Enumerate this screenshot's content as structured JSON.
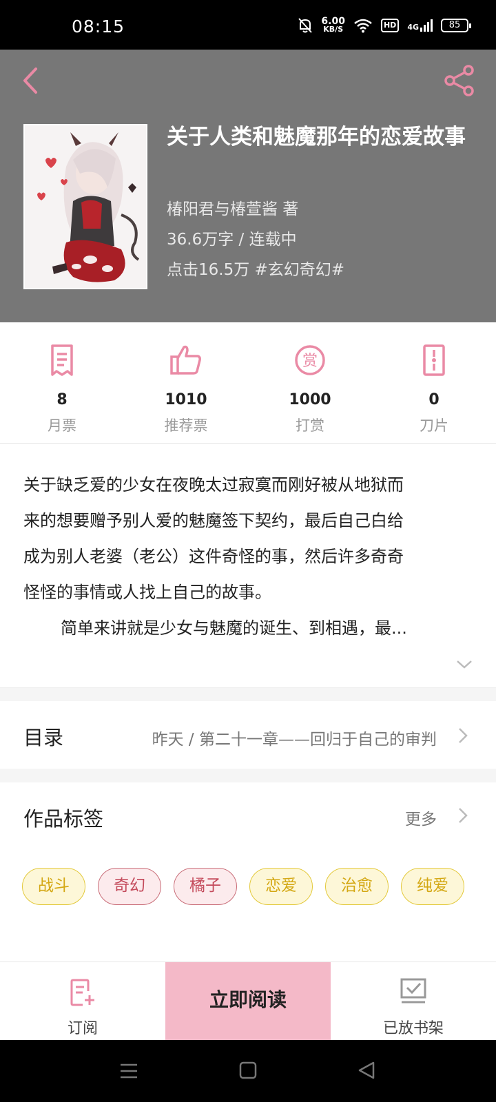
{
  "status_bar": {
    "time": "08:15",
    "net_speed_value": "6.00",
    "net_speed_unit": "KB/S",
    "hd_label": "HD",
    "signal_label": "4G",
    "battery": "85"
  },
  "book": {
    "title": "关于人类和魅魔那年的恋爱故事",
    "author": "椿阳君与椿萱酱  著",
    "words_status": "36.6万字 / 连载中",
    "hits_genre": "点击16.5万  #玄幻奇幻#"
  },
  "stats": [
    {
      "value": "8",
      "label": "月票",
      "icon": "monthly-ticket-icon"
    },
    {
      "value": "1010",
      "label": "推荐票",
      "icon": "thumbs-up-icon"
    },
    {
      "value": "1000",
      "label": "打赏",
      "icon": "reward-icon"
    },
    {
      "value": "0",
      "label": "刀片",
      "icon": "blade-icon"
    }
  ],
  "intro": {
    "line1": "关于缺乏爱的少女在夜晚太过寂寞而刚好被从地狱而",
    "line2": "来的想要赠予别人爱的魅魔签下契约，最后自己白给",
    "line3": "成为别人老婆（老公）这件奇怪的事，然后许多奇奇",
    "line4": "怪怪的事情或人找上自己的故事。",
    "line5": "简单来讲就是少女与魅魔的诞生、到相遇，最..."
  },
  "toc": {
    "title": "目录",
    "latest": "昨天 / 第二十一章——回归于自己的审判"
  },
  "tags": {
    "title": "作品标签",
    "more": "更多",
    "items": [
      "战斗",
      "奇幻",
      "橘子",
      "恋爱",
      "治愈",
      "纯爱"
    ]
  },
  "actions": {
    "subscribe": "订阅",
    "read_now": "立即阅读",
    "on_shelf": "已放书架"
  },
  "colors": {
    "accent_pink": "#f4b9c8",
    "icon_pink": "#ea8aa5",
    "header_gray": "#777777",
    "tag_yellow": "#e3c93b",
    "tag_pink": "#c96d78"
  }
}
